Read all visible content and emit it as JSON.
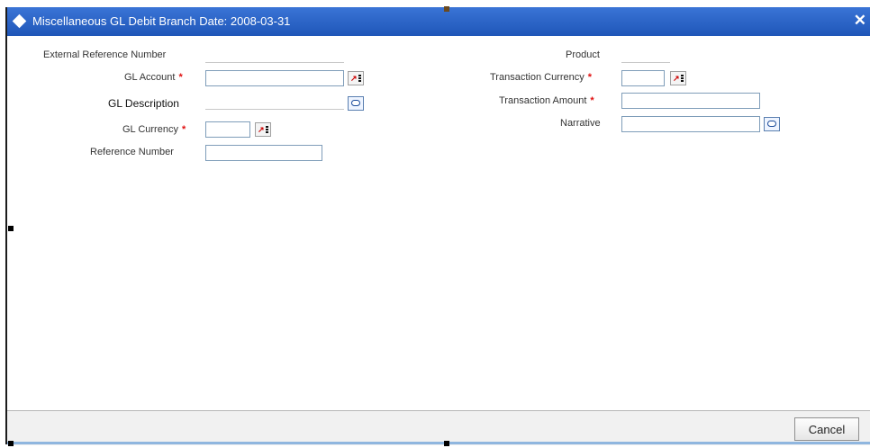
{
  "window": {
    "title": "Miscellaneous GL Debit  Branch Date: 2008-03-31"
  },
  "form": {
    "external_reference_number": {
      "label": "External Reference Number",
      "value": ""
    },
    "gl_account": {
      "label": "GL Account",
      "value": "",
      "required_mark": "*"
    },
    "gl_description": {
      "label": "GL  Description",
      "value": ""
    },
    "gl_currency": {
      "label": "GL Currency",
      "value": "",
      "required_mark": "*"
    },
    "reference_number": {
      "label": "Reference Number",
      "value": ""
    },
    "product": {
      "label": "Product",
      "value": ""
    },
    "transaction_currency": {
      "label": "Transaction Currency",
      "value": "",
      "required_mark": "*"
    },
    "transaction_amount": {
      "label": "Transaction Amount",
      "value": "",
      "required_mark": "*"
    },
    "narrative": {
      "label": "Narrative",
      "value": ""
    }
  },
  "footer": {
    "cancel_label": "Cancel"
  },
  "icons": {
    "lov": "list-of-values-icon",
    "comment": "comment-icon",
    "close": "close-icon"
  },
  "colors": {
    "title_bar": "#2a63c8",
    "required": "#e01010",
    "input_border": "#7f9db9"
  }
}
